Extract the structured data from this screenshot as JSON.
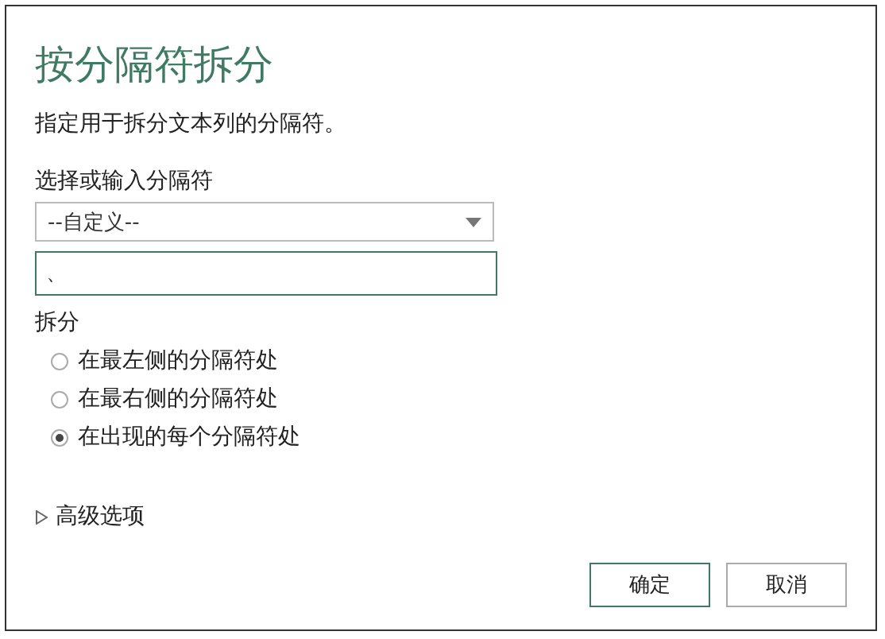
{
  "dialog": {
    "title": "按分隔符拆分",
    "description": "指定用于拆分文本列的分隔符。"
  },
  "delimiter": {
    "label": "选择或输入分隔符",
    "dropdown": {
      "value": "--自定义--"
    },
    "input": {
      "value": "、"
    }
  },
  "split": {
    "label": "拆分",
    "options": [
      {
        "label": "在最左侧的分隔符处",
        "selected": false
      },
      {
        "label": "在最右侧的分隔符处",
        "selected": false
      },
      {
        "label": "在出现的每个分隔符处",
        "selected": true
      }
    ]
  },
  "advanced": {
    "label": "高级选项",
    "expanded": false
  },
  "buttons": [
    {
      "label": "确定",
      "kind": "primary"
    },
    {
      "label": "取消",
      "kind": "secondary"
    }
  ]
}
